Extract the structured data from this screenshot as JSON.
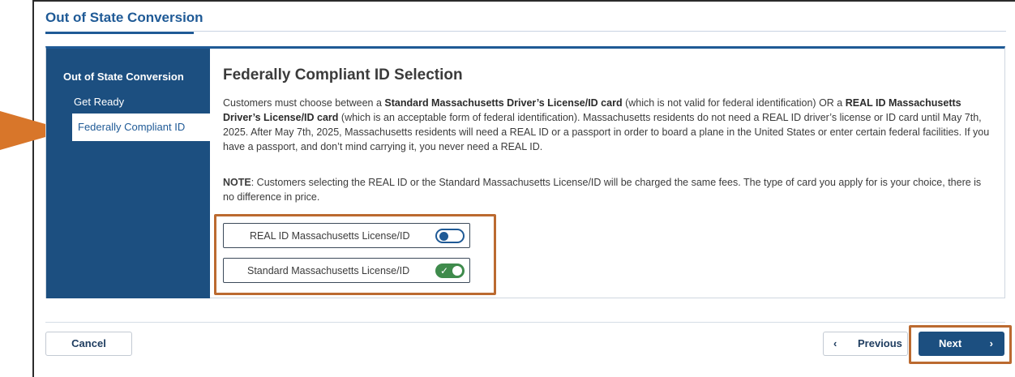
{
  "header": {
    "title": "Out of State Conversion"
  },
  "sidebar": {
    "section_title": "Out of State Conversion",
    "items": [
      {
        "label": "Get Ready"
      },
      {
        "label": "Federally Compliant ID"
      }
    ]
  },
  "main": {
    "heading": "Federally Compliant ID Selection",
    "paragraph": {
      "p1": "Customers must choose between a ",
      "b1": "Standard Massachusetts Driver’s License/ID card",
      "p2": " (which is not valid for federal identification) OR a ",
      "b2": "REAL ID Massachusetts Driver’s License/ID card",
      "p3": " (which is an acceptable form of federal identification). Massachusetts residents do not need a REAL ID driver’s license or ID card until May 7th, 2025. After May 7th, 2025, Massachusetts residents will need a REAL ID or a passport in order to board a plane in the United States or enter certain federal facilities. If you have a passport, and don’t mind carrying it, you never need a REAL ID."
    },
    "note": {
      "label": "NOTE",
      "text": ": Customers selecting the REAL ID or the Standard Massachusetts License/ID will be charged the same fees. The type of card you apply for is your choice, there is no difference in price."
    },
    "toggles": [
      {
        "label": "REAL ID Massachusetts License/ID",
        "on": false
      },
      {
        "label": "Standard Massachusetts License/ID",
        "on": true
      }
    ]
  },
  "footer": {
    "cancel_label": "Cancel",
    "previous_label": "Previous",
    "next_label": "Next"
  },
  "icons": {
    "prev": "chevron-left-icon",
    "next": "chevron-right-icon",
    "pointer": "pointer-arrow-icon"
  },
  "colors": {
    "brand_blue": "#1f5a96",
    "sidebar_blue": "#1c4f80",
    "highlight_orange": "#bb6a30",
    "toggle_on_green": "#3f8b4c"
  }
}
